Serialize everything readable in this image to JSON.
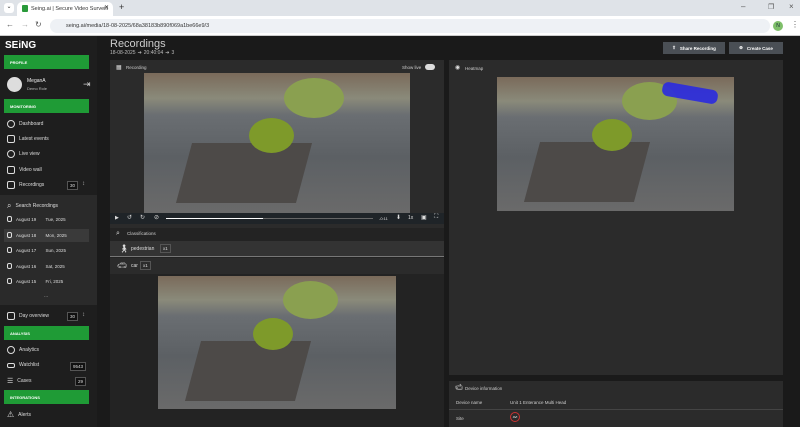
{
  "browser": {
    "tab_title": "Seing.ai | Secure Video Surveill",
    "url": "seing.ai/media/18-08-2025/68a38183b890f069a1be66e9/3",
    "new_tab": "+",
    "close": "✕"
  },
  "sidebar": {
    "logo": "SEiNG",
    "profile_label": "PROFILE",
    "user": {
      "name": "MeganA",
      "role": "Demo Role"
    },
    "monitoring_label": "MONITORING",
    "monitoring_items": [
      {
        "label": "Dashboard"
      },
      {
        "label": "Latest events"
      },
      {
        "label": "Live view"
      },
      {
        "label": "Video wall"
      },
      {
        "label": "Recordings",
        "count": "30"
      }
    ],
    "search_recordings": "Search Recordings",
    "dates": [
      {
        "date": "August 19",
        "day": "Tue, 2025"
      },
      {
        "date": "August 18",
        "day": "Mon, 2025"
      },
      {
        "date": "August 17",
        "day": "Sun, 2025"
      },
      {
        "date": "August 16",
        "day": "Sat, 2025"
      },
      {
        "date": "August 15",
        "day": "Fri, 2025"
      }
    ],
    "more": "...",
    "day_overview": {
      "label": "Day overview",
      "count": "30"
    },
    "analysis_label": "ANALYSIS",
    "analysis_items": [
      {
        "label": "Analytics"
      },
      {
        "label": "Watchlist",
        "count": "9543"
      },
      {
        "label": "Cases",
        "count": "29"
      }
    ],
    "integrations_label": "INTEGRATIONS",
    "integration_items": [
      {
        "label": "Alerts"
      }
    ]
  },
  "header": {
    "title": "Recordings",
    "date": "18-08-2025",
    "time": "20:40:04",
    "index": "3",
    "arrow": "➔",
    "share_label": "Share Recording",
    "create_case_label": "Create Case"
  },
  "recording": {
    "title": "Recording",
    "show_live": "Show live",
    "time_remaining": "-0:11",
    "speed": "1x",
    "progress": 0.47
  },
  "classifications": {
    "title": "Classifications",
    "items": [
      {
        "label": "pedestrian",
        "count": "x1"
      },
      {
        "label": "car",
        "count": "x1"
      }
    ]
  },
  "heatmap": {
    "title": "Heatmap"
  },
  "device": {
    "title": "Device information",
    "rows": [
      {
        "key": "Device name",
        "value": "Unit 1 Enterance Multi Head"
      },
      {
        "key": "Site",
        "value": "AVI"
      }
    ]
  }
}
